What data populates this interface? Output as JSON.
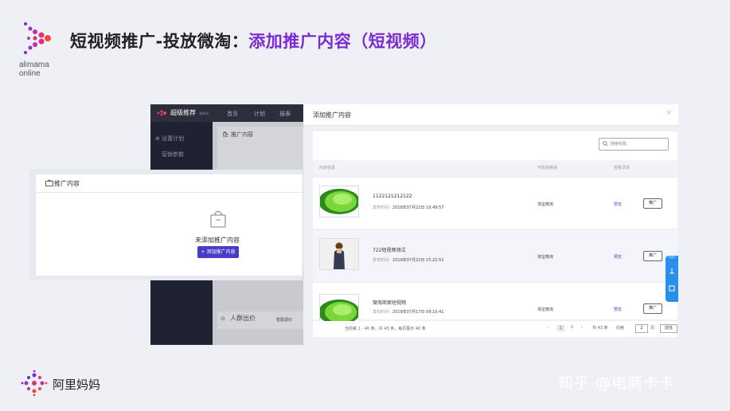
{
  "header": {
    "logo_text_1": "alimama",
    "logo_text_2": "online",
    "title_part1": "短视频推广-投放微淘：",
    "title_part2": "添加推广内容（短视频）",
    "title_color_main": "#222222",
    "title_color_accent": "#7b2bd6"
  },
  "app": {
    "brand": "超级推荐",
    "brand_badge": "beta",
    "nav": [
      "首页",
      "计划",
      "报表"
    ],
    "side_items": [
      "设置计划",
      "营销参数"
    ],
    "main_card_title": "推广内容",
    "bottom_card_label": "人群出价",
    "bottom_card_right": "智能调价"
  },
  "overlay": {
    "title": "推广内容",
    "empty_text": "未添加推广内容",
    "add_button": "+ 添加推广内容"
  },
  "modal": {
    "title": "添加推广内容",
    "close": "×",
    "search_placeholder": "搜索标题",
    "columns": [
      "内容信息",
      "可投放渠道",
      "查看详情"
    ],
    "rows": [
      {
        "title": "1122121212122",
        "date_label": "发布时间：",
        "date": "2019年07月22日 19:49:57",
        "source": "淘宝微淘",
        "preview": "预览",
        "button": "推广",
        "thumb": "green"
      },
      {
        "title": "722短视频测试",
        "date_label": "发布时间：",
        "date": "2019年07月22日 15:22:51",
        "source": "淘宝微淘",
        "preview": "预览",
        "button": "推广",
        "thumb": "person"
      },
      {
        "title": "微淘商家短视频",
        "date_label": "发布时间：",
        "date": "2019年07月17日 09:10:41",
        "source": "淘宝微淘",
        "preview": "预览",
        "button": "推广",
        "thumb": "green"
      }
    ],
    "pager": {
      "info": "当前第 1 - 40 条，共 43 条，每页展示 40 条",
      "pages": [
        "1",
        "2"
      ],
      "current": "1",
      "total": "共 43 条",
      "goto_label": "向第",
      "goto_value": "2",
      "page_unit": "页",
      "goto_button": "前往"
    }
  },
  "footer": {
    "brand": "阿里妈妈",
    "watermark": "知乎 @电商卡卡"
  },
  "colors": {
    "primary": "#4a3cc9",
    "dark_sidebar": "#1f2233",
    "float_bar": "#2a8fe8"
  }
}
